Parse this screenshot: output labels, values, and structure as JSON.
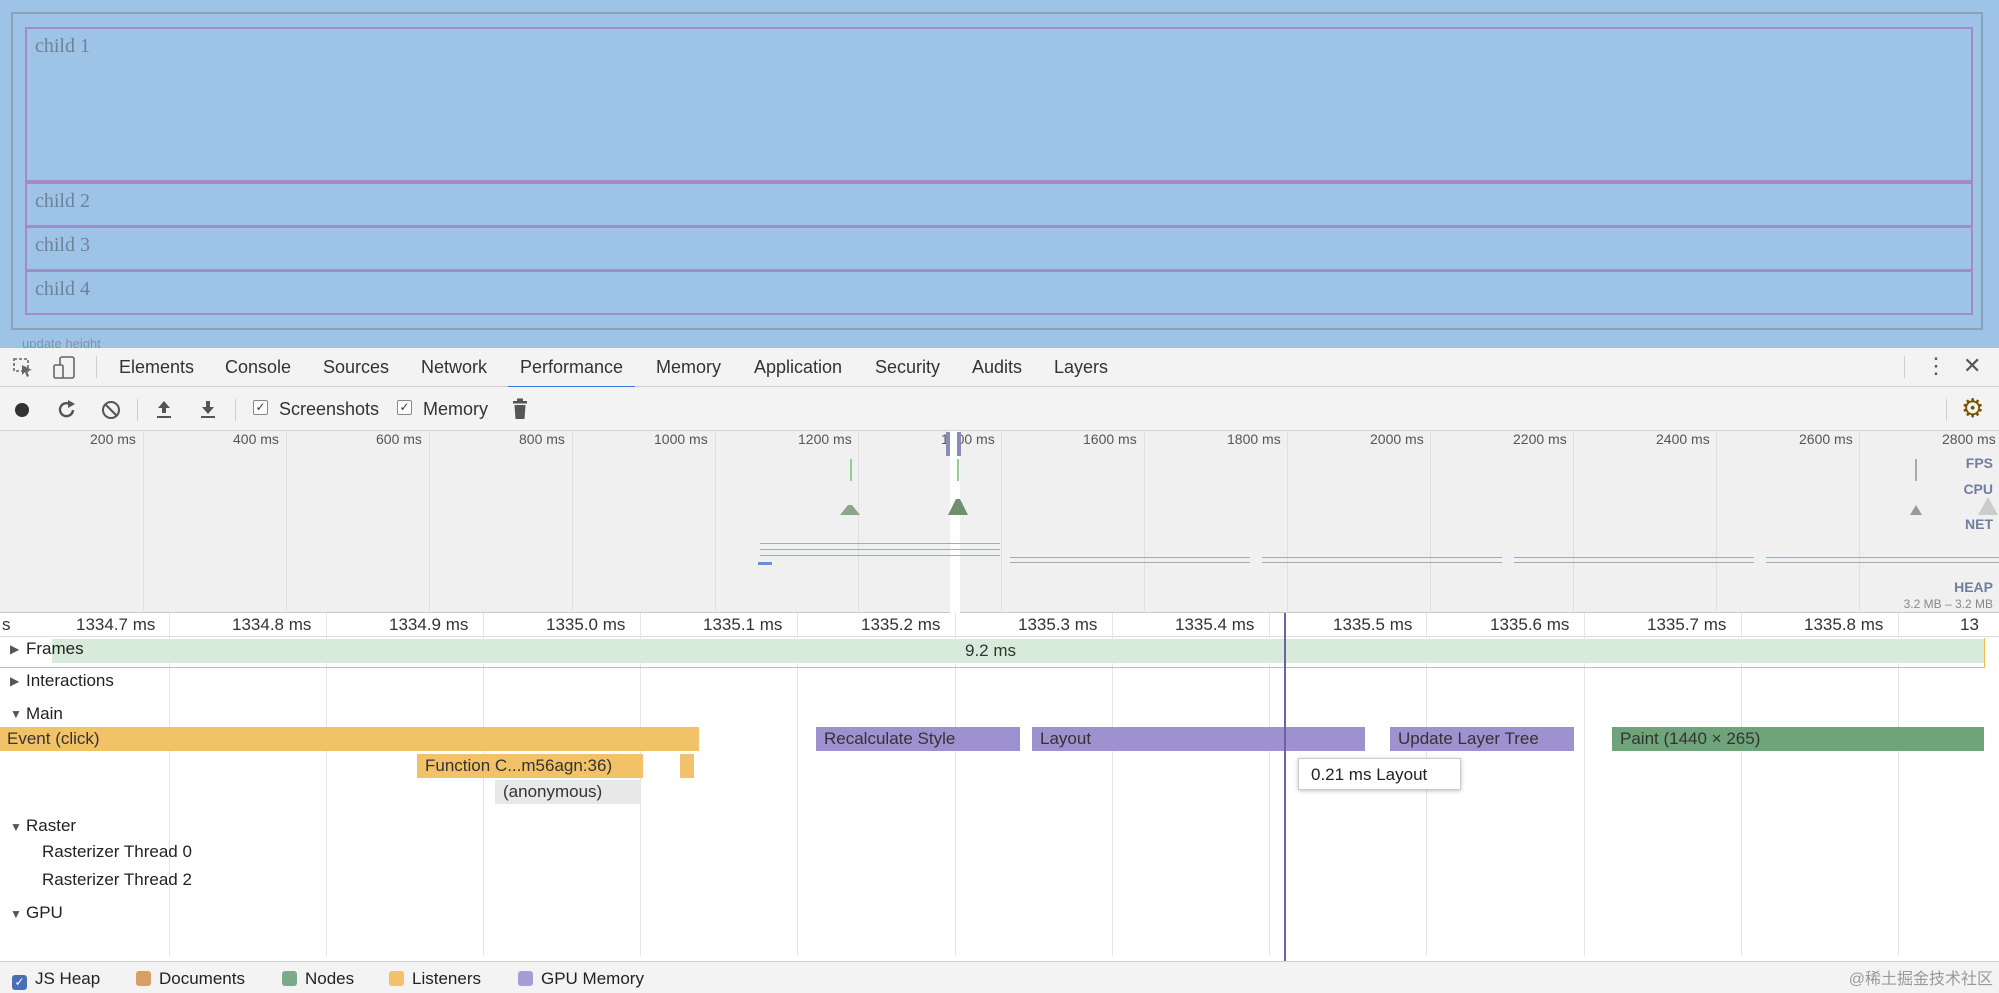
{
  "preview": {
    "children": [
      "child 1",
      "child 2",
      "child 3",
      "child 4"
    ],
    "update_button": "update height"
  },
  "devtools": {
    "tabs": [
      "Elements",
      "Console",
      "Sources",
      "Network",
      "Performance",
      "Memory",
      "Application",
      "Security",
      "Audits",
      "Layers"
    ],
    "active_tab": "Performance",
    "toolbar": {
      "screenshots_label": "Screenshots",
      "screenshots_checked": true,
      "memory_label": "Memory",
      "memory_checked": true
    },
    "overview": {
      "ticks": [
        "200 ms",
        "400 ms",
        "600 ms",
        "800 ms",
        "1000 ms",
        "1200 ms",
        "1400 ms",
        "1600 ms",
        "1800 ms",
        "2000 ms",
        "2200 ms",
        "2400 ms",
        "2600 ms",
        "2800 ms"
      ],
      "labels": [
        "FPS",
        "CPU",
        "NET",
        "HEAP"
      ],
      "heap_range": "3.2 MB – 3.2 MB"
    },
    "ruler": [
      "1334.7 ms",
      "1334.8 ms",
      "1334.9 ms",
      "1335.0 ms",
      "1335.1 ms",
      "1335.2 ms",
      "1335.3 ms",
      "1335.4 ms",
      "1335.5 ms",
      "1335.6 ms",
      "1335.7 ms",
      "1335.8 ms"
    ],
    "tracks": {
      "frames": "Frames",
      "frame_duration": "9.2 ms",
      "interactions": "Interactions",
      "main": "Main",
      "raster": "Raster",
      "raster_threads": [
        "Rasterizer Thread 0",
        "Rasterizer Thread 2"
      ],
      "gpu": "GPU"
    },
    "events": {
      "click": "Event (click)",
      "function_call": "Function C...m56agn:36)",
      "anonymous": "(anonymous)",
      "recalc_style": "Recalculate Style",
      "layout": "Layout",
      "update_layer_tree": "Update Layer Tree",
      "paint": "Paint (1440 × 265)"
    },
    "tooltip": {
      "duration": "0.21 ms",
      "name": "Layout"
    },
    "legend": [
      "JS Heap",
      "Documents",
      "Nodes",
      "Listeners",
      "GPU Memory"
    ],
    "colors": {
      "scripting": "#f2c268",
      "rendering": "#9d92cf",
      "painting": "#6fa37a",
      "frame": "#d8ead9",
      "accent": "#3879d9"
    }
  },
  "watermark": "@稀土掘金技术社区"
}
